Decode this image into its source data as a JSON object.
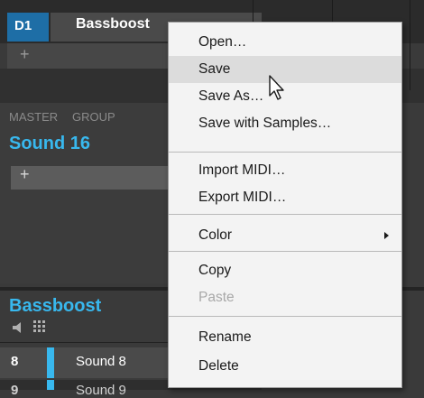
{
  "group_header": {
    "group_id": "D1",
    "group_name": "Bassboost",
    "add_symbol": "+"
  },
  "sound_panel": {
    "tabs": [
      "MASTER",
      "GROUP"
    ],
    "sound_title": "Sound 16",
    "add_symbol": "+"
  },
  "group_list": {
    "title": "Bassboost",
    "speaker_icon": "speaker-icon",
    "grid_icon": "grid-icon",
    "rows": [
      {
        "num": "8",
        "name": "Sound 8"
      },
      {
        "num": "9",
        "name": "Sound 9"
      }
    ]
  },
  "context_menu": {
    "open": "Open…",
    "save": "Save",
    "save_as": "Save As…",
    "save_with_samples": "Save with Samples…",
    "import_midi": "Import MIDI…",
    "export_midi": "Export MIDI…",
    "color": "Color",
    "copy": "Copy",
    "paste": "Paste",
    "rename": "Rename",
    "delete": "Delete"
  },
  "colors": {
    "accent": "#38b8ee",
    "group_highlight": "#1e6ea6",
    "menu_bg": "#f3f3f3",
    "menu_hover": "#dcdcdc"
  }
}
